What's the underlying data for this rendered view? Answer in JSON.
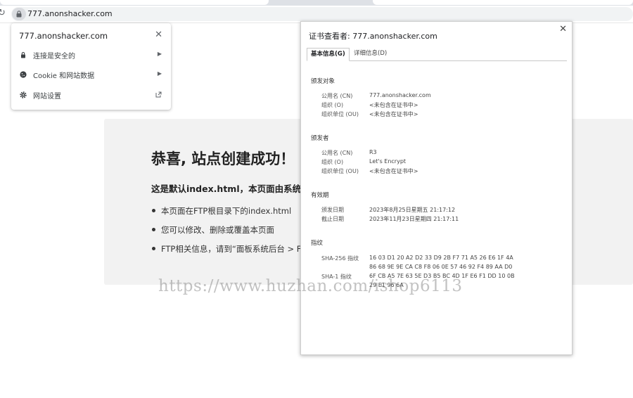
{
  "browser": {
    "url": "777.anonshacker.com"
  },
  "page": {
    "title": "恭喜, 站点创建成功！",
    "subtitle": "这是默认index.html，本页面由系统",
    "bullets": [
      "本页面在FTP根目录下的index.html",
      "您可以修改、删除或覆盖本页面",
      "FTP相关信息，请到“面板系统后台 > F"
    ]
  },
  "site_info_popup": {
    "title": "777.anonshacker.com",
    "items": [
      {
        "label": "连接是安全的",
        "icon": "lock-icon"
      },
      {
        "label": "Cookie 和网站数据",
        "icon": "cookie-icon"
      },
      {
        "label": "网站设置",
        "icon": "gear-icon"
      }
    ]
  },
  "certificate_viewer": {
    "title": "证书查看者: 777.anonshacker.com",
    "tabs": [
      "基本信息(G)",
      "详细信息(D)"
    ],
    "issued_to": {
      "heading": "颁发对象",
      "fields": [
        {
          "label": "公用名 (CN)",
          "value": "777.anonshacker.com"
        },
        {
          "label": "组织 (O)",
          "value": "<未包含在证书中>"
        },
        {
          "label": "组织单位 (OU)",
          "value": "<未包含在证书中>"
        }
      ]
    },
    "issued_by": {
      "heading": "颁发者",
      "fields": [
        {
          "label": "公用名 (CN)",
          "value": "R3"
        },
        {
          "label": "组织 (O)",
          "value": "Let's Encrypt"
        },
        {
          "label": "组织单位 (OU)",
          "value": "<未包含在证书中>"
        }
      ]
    },
    "validity": {
      "heading": "有效期",
      "fields": [
        {
          "label": "颁发日期",
          "value": "2023年8月25日星期五 21:17:12"
        },
        {
          "label": "截止日期",
          "value": "2023年11月23日星期四 21:17:11"
        }
      ]
    },
    "fingerprints": {
      "heading": "指纹",
      "sha256_label": "SHA-256 指纹",
      "sha256_line1": "16 03 D1 20 A2 D2 33 D9 2B F7 71 A5 26 E6 1F 4A",
      "sha256_line2": "86 68 9E 9E CA C8 F8 06 0E 57 46 92 F4 89 AA D0",
      "sha1_label": "SHA-1 指纹",
      "sha1_line1": "6F CB A5 7E 63 5E D3 B5 BC 4D 1F E6 F1 DD 10 0B",
      "sha1_line2": "29 E1 96 6A"
    }
  },
  "watermark": "https://www.huzhan.com/ishop6113"
}
